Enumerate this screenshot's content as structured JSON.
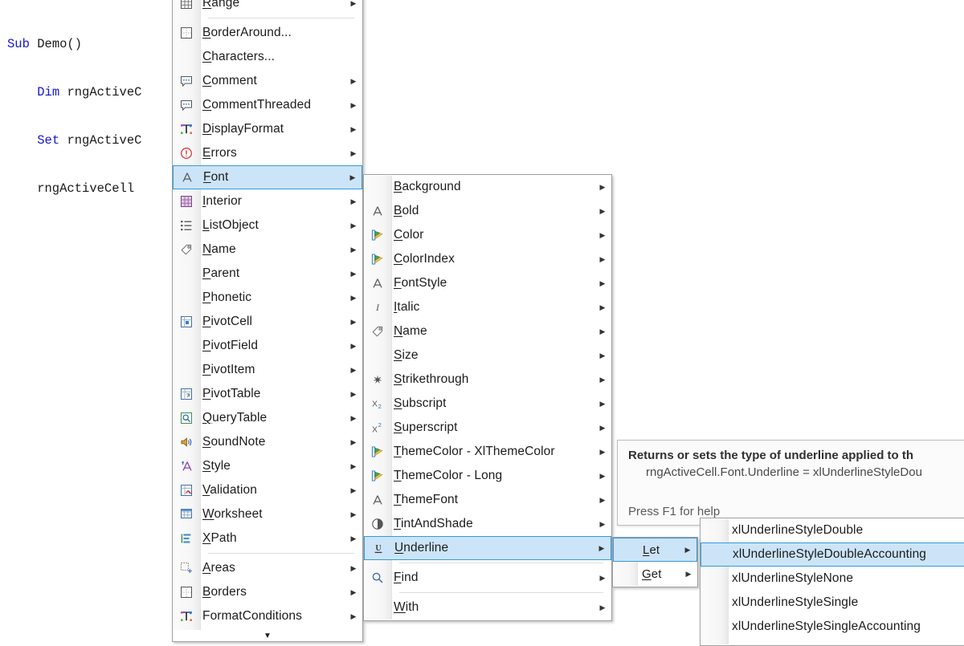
{
  "editor": {
    "lines": [
      [
        {
          "t": "Sub ",
          "k": true
        },
        {
          "t": "Demo()",
          "k": false
        }
      ],
      [
        {
          "t": "    Dim ",
          "k": true
        },
        {
          "t": "rngActiveC",
          "k": false
        }
      ],
      [
        {
          "t": "    Set ",
          "k": true
        },
        {
          "t": "rngActiveC",
          "k": false
        }
      ],
      [
        {
          "t": "    rngActiveCell",
          "k": false
        }
      ]
    ]
  },
  "menu_range": {
    "name": "Range members",
    "items": [
      {
        "label": "Range",
        "accel": "R",
        "icon": "grid-icon",
        "arrow": true,
        "selected": false
      },
      {
        "separator": true
      },
      {
        "label": "BorderAround...",
        "accel": "B",
        "icon": "border-around-icon",
        "arrow": false,
        "selected": false
      },
      {
        "label": "Characters...",
        "accel": "C",
        "icon": "none",
        "arrow": false,
        "selected": false
      },
      {
        "label": "Comment",
        "accel": "C",
        "icon": "comment-icon",
        "arrow": true,
        "selected": false
      },
      {
        "label": "CommentThreaded",
        "accel": "C",
        "icon": "comment-icon",
        "arrow": true,
        "selected": false
      },
      {
        "label": "DisplayFormat",
        "accel": "D",
        "icon": "text-format-icon",
        "arrow": true,
        "selected": false
      },
      {
        "label": "Errors",
        "accel": "E",
        "icon": "error-icon",
        "arrow": true,
        "selected": false
      },
      {
        "label": "Font",
        "accel": "F",
        "icon": "font-a-icon",
        "arrow": true,
        "selected": true
      },
      {
        "label": "Interior",
        "accel": "I",
        "icon": "interior-icon",
        "arrow": true,
        "selected": false
      },
      {
        "label": "ListObject",
        "accel": "L",
        "icon": "list-icon",
        "arrow": true,
        "selected": false
      },
      {
        "label": "Name",
        "accel": "N",
        "icon": "tag-icon",
        "arrow": true,
        "selected": false
      },
      {
        "label": "Parent",
        "accel": "P",
        "icon": "none",
        "arrow": true,
        "selected": false
      },
      {
        "label": "Phonetic",
        "accel": "P",
        "icon": "none",
        "arrow": true,
        "selected": false
      },
      {
        "label": "PivotCell",
        "accel": "P",
        "icon": "pivot-cell-icon",
        "arrow": true,
        "selected": false
      },
      {
        "label": "PivotField",
        "accel": "P",
        "icon": "none",
        "arrow": true,
        "selected": false
      },
      {
        "label": "PivotItem",
        "accel": "P",
        "icon": "none",
        "arrow": true,
        "selected": false
      },
      {
        "label": "PivotTable",
        "accel": "P",
        "icon": "pivot-table-icon",
        "arrow": true,
        "selected": false
      },
      {
        "label": "QueryTable",
        "accel": "Q",
        "icon": "query-table-icon",
        "arrow": true,
        "selected": false
      },
      {
        "label": "SoundNote",
        "accel": "S",
        "icon": "sound-note-icon",
        "arrow": true,
        "selected": false
      },
      {
        "label": "Style",
        "accel": "S",
        "icon": "style-a-icon",
        "arrow": true,
        "selected": false
      },
      {
        "label": "Validation",
        "accel": "V",
        "icon": "validation-icon",
        "arrow": true,
        "selected": false
      },
      {
        "label": "Worksheet",
        "accel": "W",
        "icon": "worksheet-icon",
        "arrow": true,
        "selected": false
      },
      {
        "label": "XPath",
        "accel": "X",
        "icon": "xpath-icon",
        "arrow": true,
        "selected": false
      },
      {
        "separator": true
      },
      {
        "label": "Areas",
        "accel": "A",
        "icon": "areas-icon",
        "arrow": true,
        "selected": false
      },
      {
        "label": "Borders",
        "accel": "B",
        "icon": "borders-icon",
        "arrow": true,
        "selected": false
      },
      {
        "label": "FormatConditions",
        "accel": "",
        "icon": "text-format-icon",
        "arrow": true,
        "selected": false
      }
    ],
    "scroll_down_glyph": "▼"
  },
  "menu_font": {
    "name": "Font members",
    "items": [
      {
        "label": "Background",
        "accel": "B",
        "icon": "none",
        "arrow": true,
        "selected": false
      },
      {
        "label": "Bold",
        "accel": "B",
        "icon": "font-a-icon",
        "arrow": true,
        "selected": false
      },
      {
        "label": "Color",
        "accel": "C",
        "icon": "color-palette-icon",
        "arrow": true,
        "selected": false
      },
      {
        "label": "ColorIndex",
        "accel": "C",
        "icon": "color-palette-icon",
        "arrow": true,
        "selected": false
      },
      {
        "label": "FontStyle",
        "accel": "F",
        "icon": "font-a-icon",
        "arrow": true,
        "selected": false
      },
      {
        "label": "Italic",
        "accel": "I",
        "icon": "italic-icon",
        "arrow": true,
        "selected": false
      },
      {
        "label": "Name",
        "accel": "N",
        "icon": "tag-icon",
        "arrow": true,
        "selected": false
      },
      {
        "label": "Size",
        "accel": "S",
        "icon": "none",
        "arrow": true,
        "selected": false
      },
      {
        "label": "Strikethrough",
        "accel": "S",
        "icon": "strikethrough-icon",
        "arrow": true,
        "selected": false
      },
      {
        "label": "Subscript",
        "accel": "S",
        "icon": "subscript-icon",
        "arrow": true,
        "selected": false
      },
      {
        "label": "Superscript",
        "accel": "S",
        "icon": "superscript-icon",
        "arrow": true,
        "selected": false
      },
      {
        "label": "ThemeColor - XlThemeColor",
        "accel": "T",
        "icon": "color-palette-icon",
        "arrow": true,
        "selected": false
      },
      {
        "label": "ThemeColor - Long",
        "accel": "T",
        "icon": "color-palette-icon",
        "arrow": true,
        "selected": false
      },
      {
        "label": "ThemeFont",
        "accel": "T",
        "icon": "font-a-icon",
        "arrow": true,
        "selected": false
      },
      {
        "label": "TintAndShade",
        "accel": "T",
        "icon": "tint-shade-icon",
        "arrow": true,
        "selected": false
      },
      {
        "label": "Underline",
        "accel": "U",
        "icon": "underline-icon",
        "arrow": true,
        "selected": true
      },
      {
        "separator": true
      },
      {
        "label": "Find",
        "accel": "F",
        "icon": "search-icon",
        "arrow": true,
        "selected": false
      },
      {
        "separator": true
      },
      {
        "label": "With",
        "accel": "W",
        "icon": "none",
        "arrow": true,
        "selected": false
      }
    ]
  },
  "menu_letget": {
    "name": "Property accessor",
    "items": [
      {
        "label": "Let",
        "accel": "L",
        "icon": "none",
        "arrow": true,
        "selected": true
      },
      {
        "label": "Get",
        "accel": "G",
        "icon": "none",
        "arrow": true,
        "selected": false
      }
    ]
  },
  "menu_enum": {
    "name": "XlUnderlineStyle values",
    "items": [
      {
        "label": "xlUnderlineStyleDouble",
        "icon": "none",
        "arrow": false,
        "selected": false
      },
      {
        "label": "xlUnderlineStyleDoubleAccounting",
        "icon": "none",
        "arrow": false,
        "selected": true
      },
      {
        "label": "xlUnderlineStyleNone",
        "icon": "none",
        "arrow": false,
        "selected": false
      },
      {
        "label": "xlUnderlineStyleSingle",
        "icon": "none",
        "arrow": false,
        "selected": false
      },
      {
        "label": "xlUnderlineStyleSingleAccounting",
        "icon": "none",
        "arrow": false,
        "selected": false
      }
    ]
  },
  "tooltip": {
    "title": "Returns or sets the type of underline applied to th",
    "code": "rngActiveCell.Font.Underline = xlUnderlineStyleDou",
    "help": "Press F1 for help"
  },
  "colors": {
    "highlight_fill": "#cce4f7",
    "highlight_border": "#3399dd",
    "menu_bg": "#ffffff",
    "menu_border": "#a0a0a0",
    "gutter_bg": "#f6f6f6",
    "keyword": "#1515cf",
    "tooltip_bg": "#fbfbfb"
  }
}
